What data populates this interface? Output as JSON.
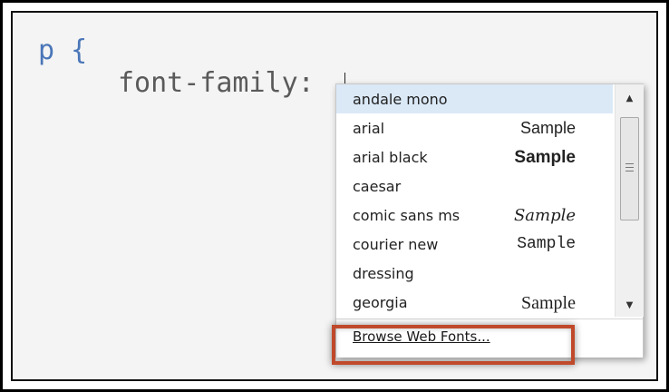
{
  "editor": {
    "line1": "p {",
    "line2": "font-family:"
  },
  "autocomplete": {
    "selected_index": 0,
    "items": [
      {
        "name": "andale mono",
        "sample": ""
      },
      {
        "name": "arial",
        "sample": "Sample"
      },
      {
        "name": "arial black",
        "sample": "Sample"
      },
      {
        "name": "caesar",
        "sample": ""
      },
      {
        "name": "comic sans ms",
        "sample": "Sample"
      },
      {
        "name": "courier new",
        "sample": "Sample"
      },
      {
        "name": "dressing",
        "sample": ""
      },
      {
        "name": "georgia",
        "sample": "Sample"
      }
    ],
    "footer_link": "Browse Web Fonts...",
    "scrollbar": {
      "up_arrow_icon": "triangle-up",
      "down_arrow_icon": "triangle-down"
    }
  },
  "colors": {
    "selector": "#4a76b8",
    "property": "#5a5a5a",
    "selected_row": "#dbe9f7",
    "highlight": "#c0492b"
  }
}
